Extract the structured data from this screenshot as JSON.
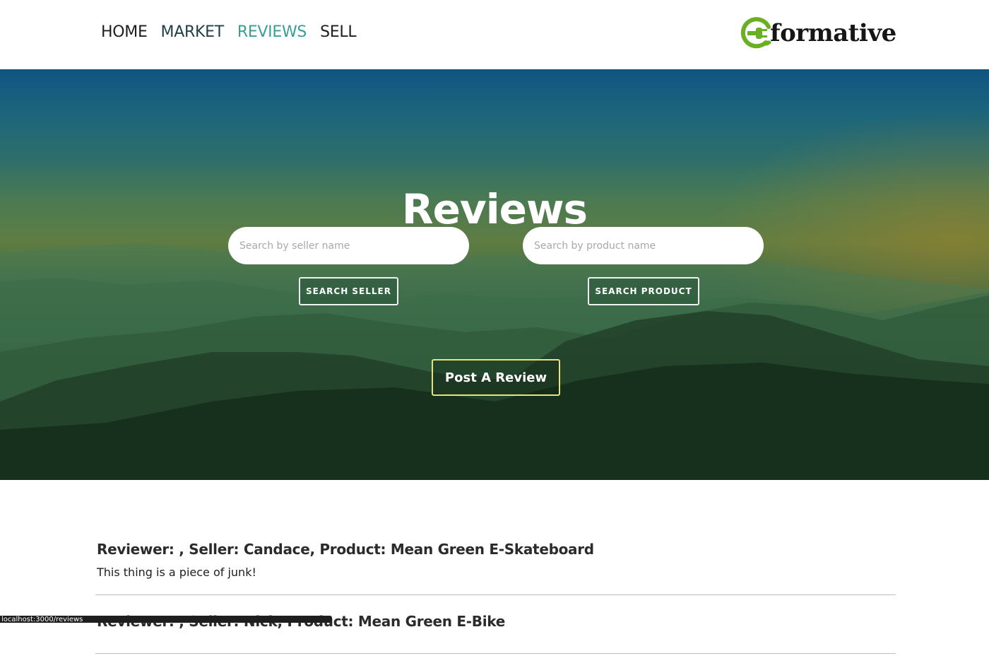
{
  "nav": {
    "links": [
      {
        "label": "HOME",
        "active": false
      },
      {
        "label": "MARKET",
        "active": false
      },
      {
        "label": "REVIEWS",
        "active": true
      },
      {
        "label": "SELL",
        "active": false
      }
    ],
    "logo": {
      "text": "formative",
      "icon": "plug-leaf-e-icon"
    }
  },
  "hero": {
    "title": "Reviews",
    "seller_search": {
      "placeholder": "Search by seller name",
      "value": "",
      "button_label": "SEARCH SELLER"
    },
    "product_search": {
      "placeholder": "Search by product name",
      "value": "",
      "button_label": "SEARCH PRODUCT"
    },
    "post_review_label": "Post A Review"
  },
  "reviews": [
    {
      "heading": "Reviewer: , Seller: Candace, Product: Mean Green E-Skateboard",
      "body": "This thing is a piece of junk!"
    },
    {
      "heading": "Reviewer: , Seller: Nick, Product: Mean Green E-Bike",
      "body": ""
    }
  ],
  "status_bar": {
    "url": "localhost:3000/reviews"
  },
  "colors": {
    "active_nav": "#3a9e96",
    "logo_green": "#6ab023",
    "post_button_border": "#e9e27a"
  }
}
